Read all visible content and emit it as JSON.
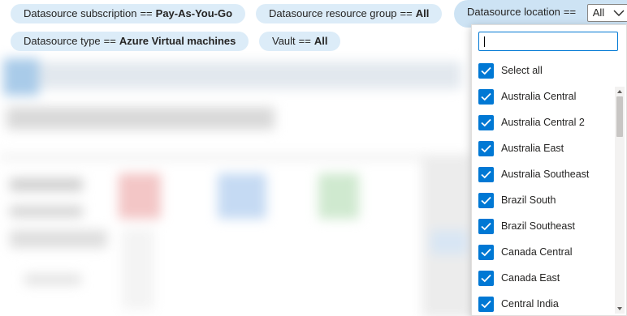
{
  "filters": [
    {
      "field": "Datasource subscription",
      "op": "==",
      "value": "Pay-As-You-Go"
    },
    {
      "field": "Datasource resource group",
      "op": "==",
      "value": "All"
    },
    {
      "field": "Datasource location",
      "op": "==",
      "value": ""
    },
    {
      "field": "Datasource type",
      "op": "==",
      "value": "Azure Virtual machines"
    },
    {
      "field": "Vault",
      "op": "==",
      "value": "All"
    }
  ],
  "location_select": {
    "selected": "All"
  },
  "dropdown": {
    "search_value": "",
    "options": [
      {
        "label": "Select all",
        "checked": true
      },
      {
        "label": "Australia Central",
        "checked": true
      },
      {
        "label": "Australia Central 2",
        "checked": true
      },
      {
        "label": "Australia East",
        "checked": true
      },
      {
        "label": "Australia Southeast",
        "checked": true
      },
      {
        "label": "Brazil South",
        "checked": true
      },
      {
        "label": "Brazil Southeast",
        "checked": true
      },
      {
        "label": "Canada Central",
        "checked": true
      },
      {
        "label": "Canada East",
        "checked": true
      },
      {
        "label": "Central India",
        "checked": true
      }
    ]
  },
  "colors": {
    "accent": "#0078d4",
    "pill_bg": "#dcecf8"
  }
}
